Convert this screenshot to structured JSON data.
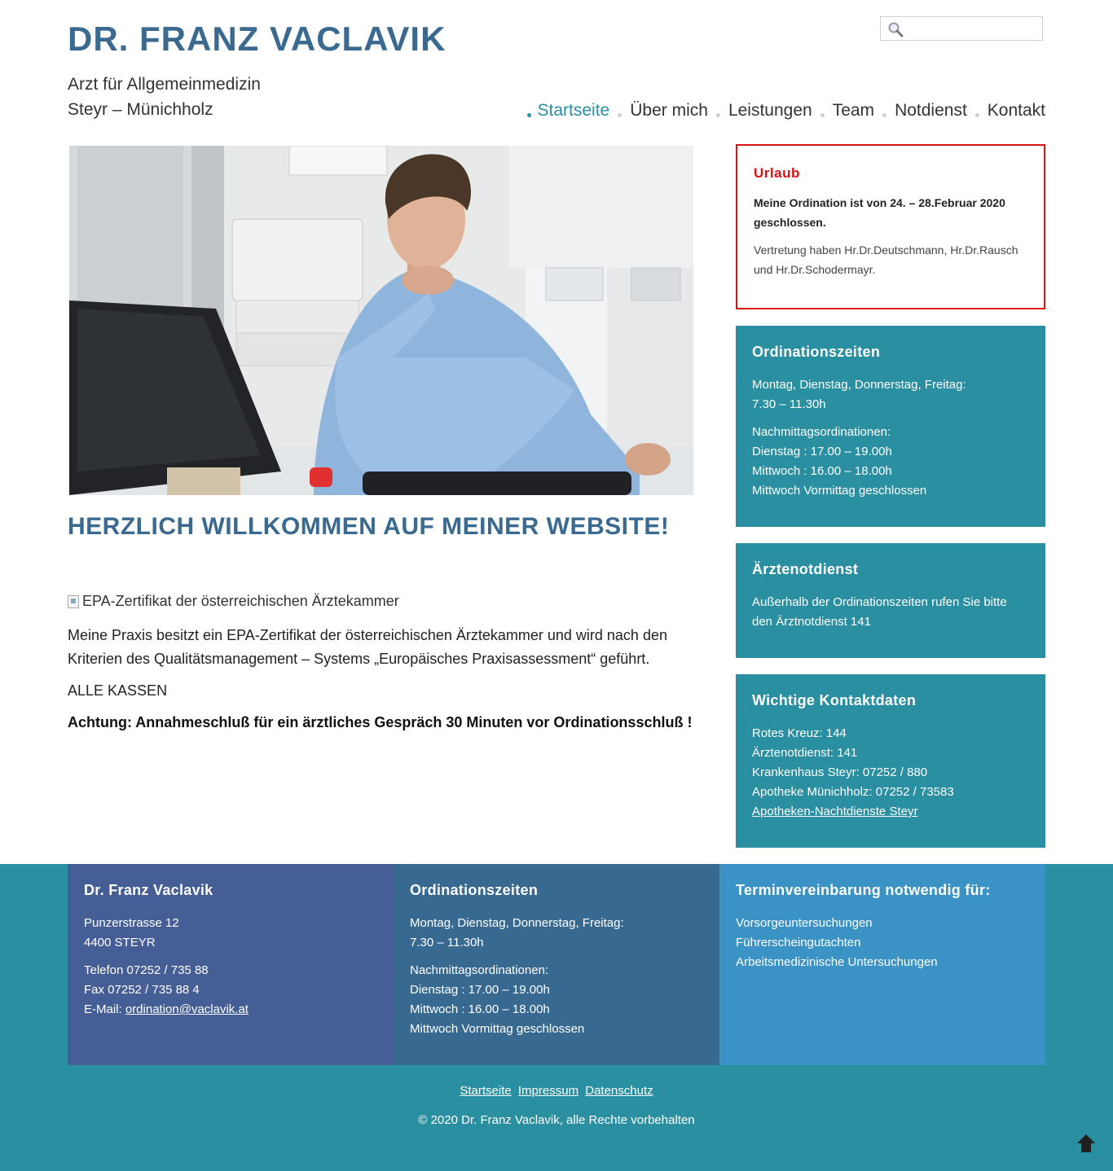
{
  "header": {
    "site_title": "DR. FRANZ VACLAVIK",
    "tagline_line1": "Arzt für Allgemeinmedizin",
    "tagline_line2": "Steyr – Münichholz",
    "search_placeholder": ""
  },
  "nav": {
    "items": [
      {
        "label": "Startseite",
        "active": true
      },
      {
        "label": "Über mich",
        "active": false
      },
      {
        "label": "Leistungen",
        "active": false
      },
      {
        "label": "Team",
        "active": false
      },
      {
        "label": "Notdienst",
        "active": false
      },
      {
        "label": "Kontakt",
        "active": false
      }
    ]
  },
  "main": {
    "welcome": "HERZLICH WILLKOMMEN AUF MEINER WEBSITE!",
    "broken_image_alt": "EPA-Zertifikat der österreichischen Ärztekammer",
    "paragraph1": "Meine Praxis besitzt ein EPA-Zertifikat der österreichischen Ärztekammer und wird nach den Kriterien des Qualitätsmanagement – Systems „Europäisches Praxisassessment“ geführt.",
    "paragraph2": "ALLE KASSEN",
    "paragraph3": "Achtung: Annahmeschluß für ein ärztliches Gespräch 30 Minuten vor Ordinationsschluß !"
  },
  "sidebar": {
    "urlaub": {
      "title": "Urlaub",
      "notice": "Meine Ordination ist von 24. – 28.Februar 2020 geschlossen.",
      "vertretung": "Vertretung haben Hr.Dr.Deutschmann, Hr.Dr.Rausch und Hr.Dr.Schodermayr."
    },
    "ordinationszeiten": {
      "title": "Ordinationszeiten",
      "days": "Montag, Dienstag, Donnerstag, Freitag:",
      "days_time": "7.30 – 11.30h",
      "afternoon_title": "Nachmittagsordinationen:",
      "dienstag": "Dienstag : 17.00 – 19.00h",
      "mittwoch": "Mittwoch : 16.00 – 18.00h",
      "closed": "Mittwoch Vormittag geschlossen"
    },
    "notdienst": {
      "title": "Ärztenotdienst",
      "text": "Außerhalb der Ordinationszeiten rufen Sie bitte den Ärztnotdienst 141"
    },
    "kontakt": {
      "title": "Wichtige Kontaktdaten",
      "rotes_kreuz": "Rotes Kreuz: 144",
      "notdienst": "Ärztenotdienst: 141",
      "krankenhaus": "Krankenhaus Steyr: 07252 / 880",
      "apotheke": "Apotheke Münichholz: 07252 / 73583",
      "link": "Apotheken-Nachtdienste Steyr"
    }
  },
  "footer": {
    "col1": {
      "title": "Dr. Franz Vaclavik",
      "street": "Punzerstrasse 12",
      "city": "4400 STEYR",
      "phone": "Telefon 07252 / 735 88",
      "fax": "Fax 07252 / 735 88 4",
      "email_label": "E-Mail: ",
      "email": "ordination@vaclavik.at"
    },
    "col2": {
      "title": "Ordinationszeiten",
      "days": "Montag, Dienstag, Donnerstag, Freitag:",
      "days_time": "7.30 – 11.30h",
      "afternoon_title": "Nachmittagsordinationen:",
      "dienstag": "Dienstag : 17.00 – 19.00h",
      "mittwoch": "Mittwoch : 16.00 – 18.00h",
      "closed": "Mittwoch Vormittag geschlossen"
    },
    "col3": {
      "title": "Terminvereinbarung notwendig für:",
      "item1": "Vorsorgeuntersuchungen",
      "item2": "Führerscheingutachten",
      "item3": "Arbeitsmedizinische Untersuchungen"
    },
    "links": [
      "Startseite",
      "Impressum",
      "Datenschutz"
    ],
    "copyright": "© 2020 Dr. Franz Vaclavik, alle Rechte vorbehalten"
  },
  "colors": {
    "title_blue": "#3a6a8f",
    "teal": "#2a8fa0",
    "alert_red": "#dd1111",
    "footer_col1": "#465e96",
    "footer_col2": "#386a91",
    "footer_col3": "#3a93c4"
  },
  "icons": {
    "search": "search-icon",
    "back_to_top": "arrow-up-icon"
  }
}
